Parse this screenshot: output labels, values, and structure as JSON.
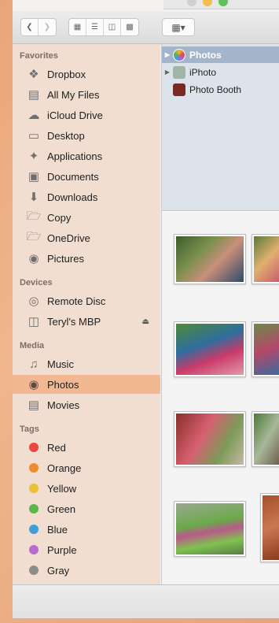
{
  "sidebar": {
    "favorites_header": "Favorites",
    "favorites": [
      {
        "label": "Dropbox",
        "icon": "dropbox-icon"
      },
      {
        "label": "All My Files",
        "icon": "all-files-icon"
      },
      {
        "label": "iCloud Drive",
        "icon": "cloud-icon"
      },
      {
        "label": "Desktop",
        "icon": "desktop-icon"
      },
      {
        "label": "Applications",
        "icon": "applications-icon"
      },
      {
        "label": "Documents",
        "icon": "documents-icon"
      },
      {
        "label": "Downloads",
        "icon": "downloads-icon"
      },
      {
        "label": "Copy",
        "icon": "folder-icon"
      },
      {
        "label": "OneDrive",
        "icon": "folder-icon"
      },
      {
        "label": "Pictures",
        "icon": "camera-icon"
      }
    ],
    "devices_header": "Devices",
    "devices": [
      {
        "label": "Remote Disc",
        "icon": "disc-icon"
      },
      {
        "label": "Teryl's MBP",
        "icon": "drive-icon"
      }
    ],
    "media_header": "Media",
    "media": [
      {
        "label": "Music",
        "icon": "music-icon"
      },
      {
        "label": "Photos",
        "icon": "camera-icon",
        "selected": true
      },
      {
        "label": "Movies",
        "icon": "film-icon"
      }
    ],
    "tags_header": "Tags",
    "tags": [
      {
        "label": "Red",
        "color": "#e8483f"
      },
      {
        "label": "Orange",
        "color": "#f08a2c"
      },
      {
        "label": "Yellow",
        "color": "#e9c22f"
      },
      {
        "label": "Green",
        "color": "#5ab848"
      },
      {
        "label": "Blue",
        "color": "#3e9fd8"
      },
      {
        "label": "Purple",
        "color": "#b86bd1"
      },
      {
        "label": "Gray",
        "color": "#8c8c8c"
      }
    ]
  },
  "browser": {
    "rows": [
      {
        "label": "Photos",
        "selected": true
      },
      {
        "label": "iPhoto"
      },
      {
        "label": "Photo Booth"
      }
    ]
  }
}
